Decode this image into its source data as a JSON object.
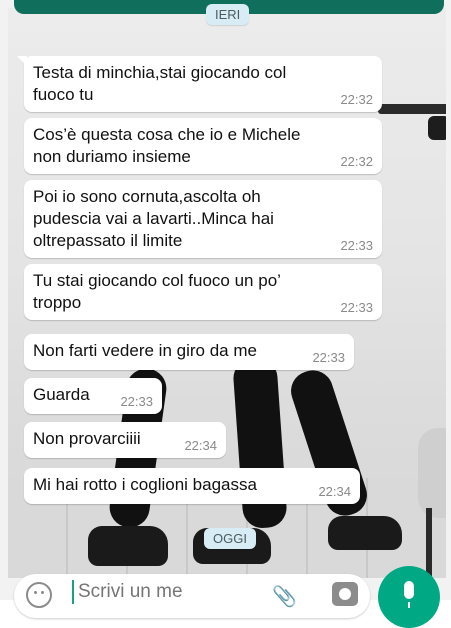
{
  "chat": {
    "date_chips": {
      "yesterday": "IERI",
      "today": "OGGI"
    },
    "messages": [
      {
        "text": "Testa di minchia,stai giocando col\nfuoco tu",
        "time": "22:32"
      },
      {
        "text": "Cos’è questa cosa che io e Michele\nnon duriamo insieme",
        "time": "22:32"
      },
      {
        "text": "Poi io sono cornuta,ascolta oh\npudescia vai a lavarti..Minca hai\noltrepassato il limite",
        "time": "22:33"
      },
      {
        "text": "Tu stai giocando col fuoco un po’\ntroppo",
        "time": "22:33"
      },
      {
        "text": "Non farti vedere in giro da me",
        "time": "22:33"
      },
      {
        "text": "Guarda",
        "time": "22:33"
      },
      {
        "text": "Non provarciiii",
        "time": "22:34"
      },
      {
        "text": "Mi hai rotto i coglioni bagassa",
        "time": "22:34"
      }
    ]
  },
  "composer": {
    "placeholder": "Scrivi un me",
    "icons": {
      "emoji": "emoji-icon",
      "attach": "paperclip-icon",
      "camera": "camera-icon",
      "mic": "microphone-icon"
    },
    "accent": "#00a884"
  },
  "colors": {
    "header": "#0f6f5c",
    "bubble": "#ffffff",
    "chip": "#d7ecf4"
  }
}
